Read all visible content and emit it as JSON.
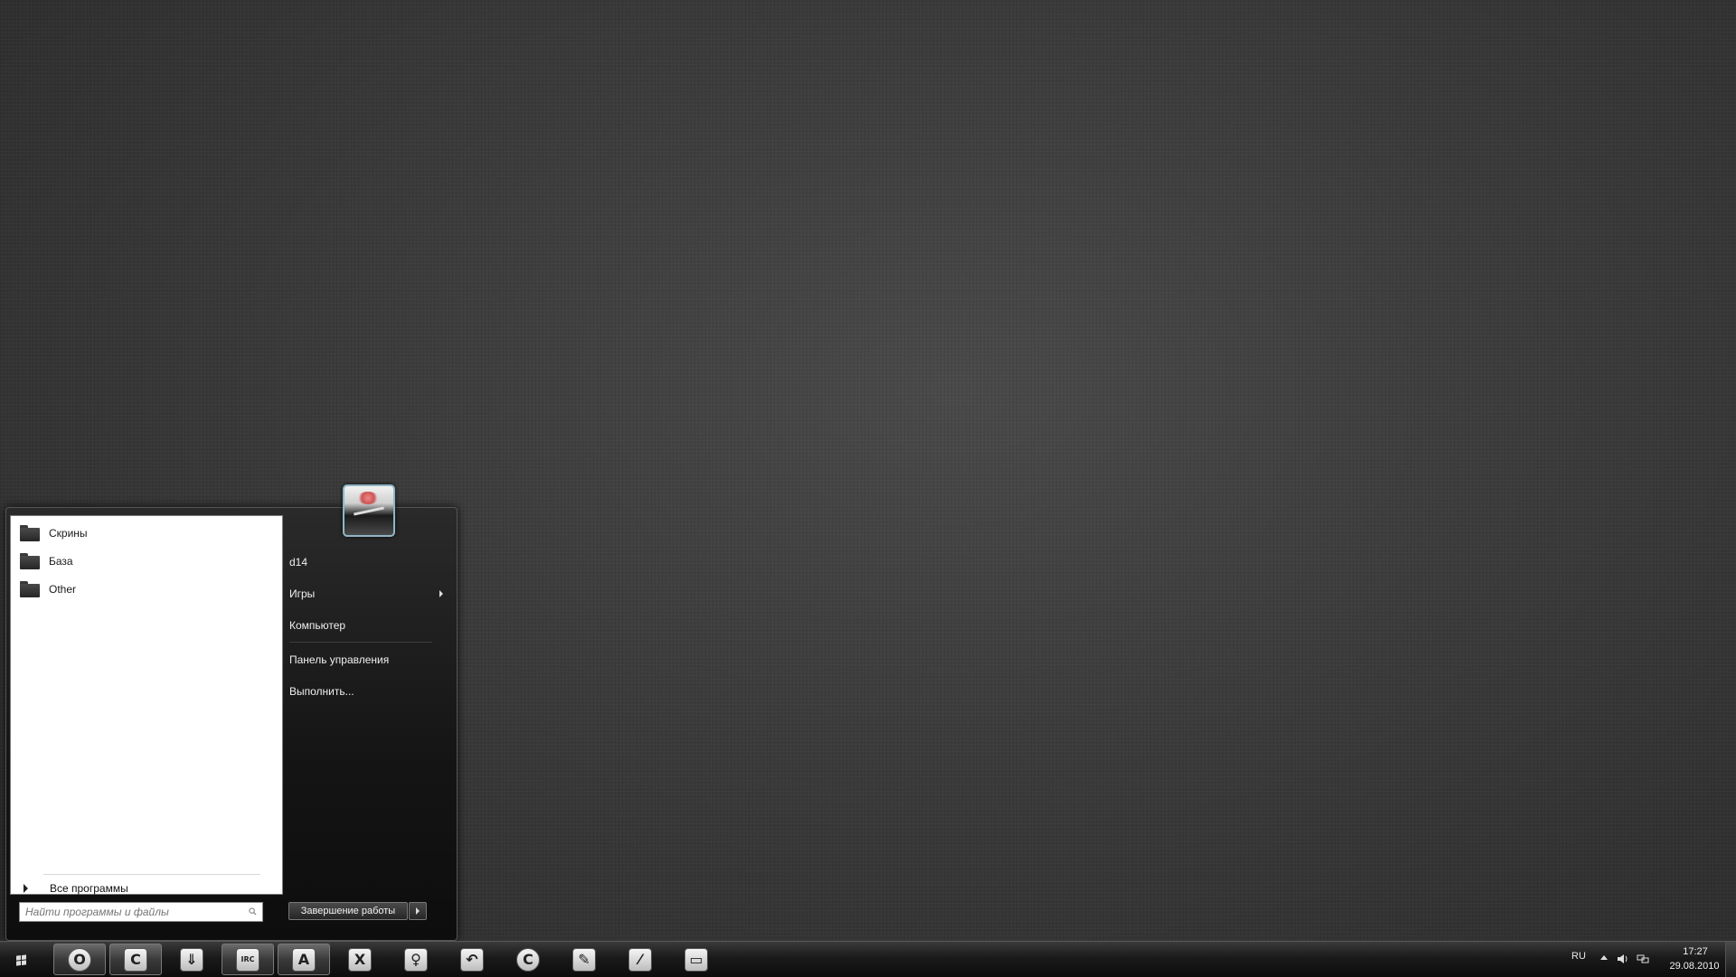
{
  "start_menu": {
    "programs": [
      {
        "label": "Скрины",
        "icon": "folder-icon"
      },
      {
        "label": "База",
        "icon": "folder-icon"
      },
      {
        "label": "Other",
        "icon": "folder-icon"
      }
    ],
    "all_programs_label": "Все программы",
    "search_placeholder": "Найти программы и файлы",
    "right_items": [
      {
        "label": "d14"
      },
      {
        "label": "Игры",
        "has_submenu": true
      },
      {
        "label": "Компьютер"
      },
      {
        "label": "Панель управления"
      },
      {
        "label": "Выполнить..."
      }
    ],
    "shutdown_label": "Завершение работы"
  },
  "taskbar": {
    "apps": [
      {
        "name": "opera",
        "glyph": "O",
        "active": true
      },
      {
        "name": "ccleaner",
        "glyph": "C",
        "active": true
      },
      {
        "name": "download-manager",
        "glyph": "⇓",
        "active": false
      },
      {
        "name": "irc-chat",
        "glyph": "IRC",
        "active": true
      },
      {
        "name": "aimp",
        "glyph": "A",
        "active": true
      },
      {
        "name": "xnview",
        "glyph": "X",
        "active": false
      },
      {
        "name": "bulb",
        "glyph": "♀",
        "active": false
      },
      {
        "name": "undo-app",
        "glyph": "↶",
        "active": false
      },
      {
        "name": "refresh-app",
        "glyph": "C",
        "active": false
      },
      {
        "name": "notes-app",
        "glyph": "✎",
        "active": false
      },
      {
        "name": "editor-app",
        "glyph": "⁄",
        "active": false
      },
      {
        "name": "display-app",
        "glyph": "▭",
        "active": false
      }
    ],
    "language": "RU",
    "time": "17:27",
    "date": "29.08.2010"
  },
  "colors": {
    "desktop": "#3b3b3b",
    "menu_dark": "#141414",
    "menu_left": "#ffffff",
    "accent_frame": "#8fb7c4"
  }
}
